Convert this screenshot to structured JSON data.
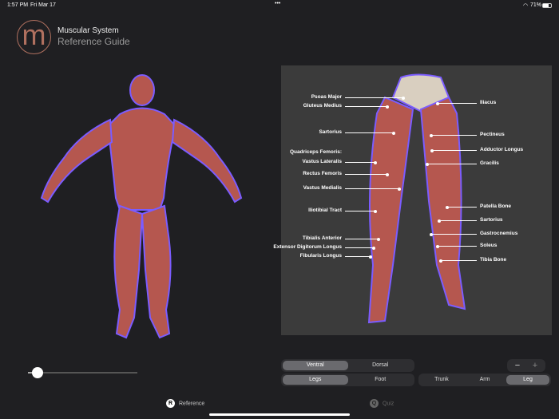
{
  "status": {
    "time": "1:57 PM",
    "date": "Fri Mar 17",
    "dots": "•••",
    "battery": "71%"
  },
  "header": {
    "logo": "m",
    "title": "Muscular System",
    "subtitle": "Reference Guide"
  },
  "slider": {
    "value": 0.1
  },
  "diagram": {
    "left_labels": [
      "Psoas Major",
      "Gluteus Medius",
      "Sartorius",
      "Quadriceps Femoris:",
      "Vastus Lateralis",
      "Rectus Femoris",
      "Vastus Medialis",
      "Iliotibial Tract",
      "Tibialis Anterior",
      "Extensor Digitorum Longus",
      "Fibularis Longus"
    ],
    "right_labels": [
      "Iliacus",
      "Pectineus",
      "Adductor Longus",
      "Gracilis",
      "Patella Bone",
      "Sartorius",
      "Gastrocnemius",
      "Soleus",
      "Tibia Bone"
    ]
  },
  "controls": {
    "view": [
      "Ventral",
      "Dorsal"
    ],
    "region": [
      "Legs",
      "Foot"
    ],
    "body": [
      "Trunk",
      "Arm",
      "Leg"
    ],
    "zoom_minus": "−",
    "zoom_plus": "+"
  },
  "tabs": [
    {
      "icon": "R",
      "label": "Reference"
    },
    {
      "icon": "Q",
      "label": "Quiz"
    }
  ],
  "colors": {
    "accent": "#b0705f",
    "muscle": "#b5574f",
    "outline": "#7b5cff"
  }
}
